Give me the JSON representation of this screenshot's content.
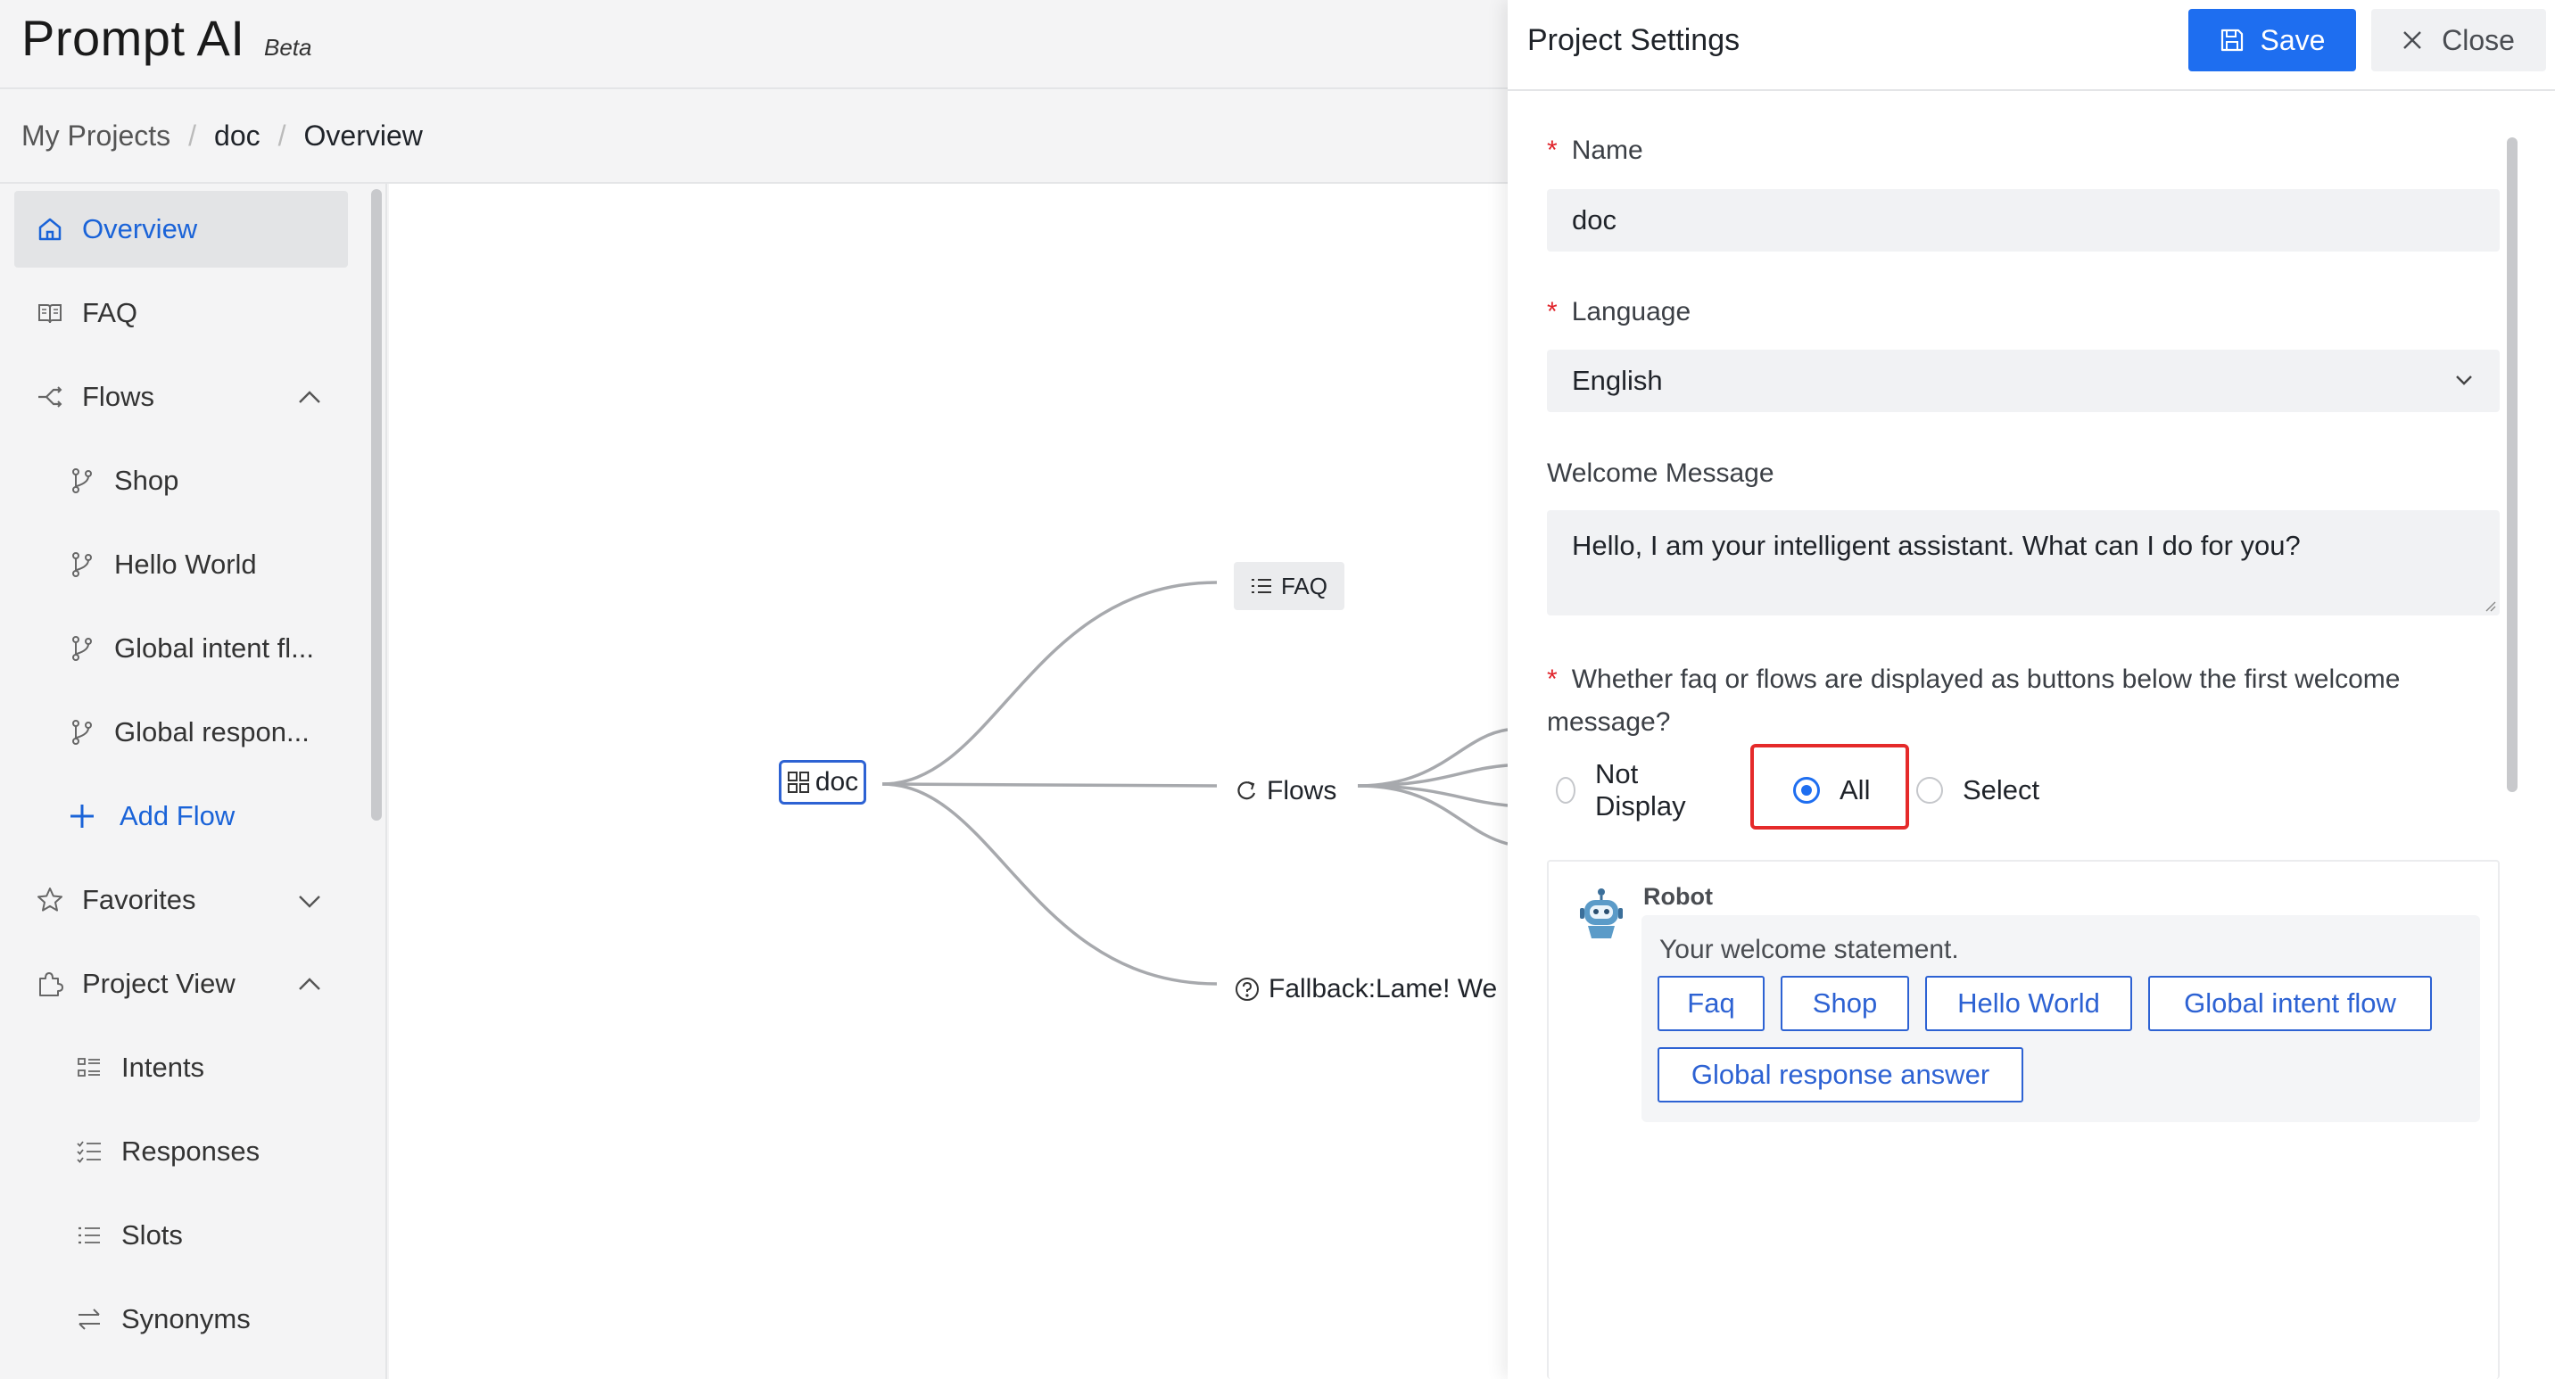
{
  "header": {
    "brand": "Prompt AI",
    "badge": "Beta"
  },
  "breadcrumb": [
    "My Projects",
    "doc",
    "Overview"
  ],
  "sidebar": {
    "overview": "Overview",
    "faq": "FAQ",
    "flows": "Flows",
    "flow_items": [
      "Shop",
      "Hello World",
      "Global intent fl...",
      "Global respon..."
    ],
    "add_flow": "Add Flow",
    "favorites": "Favorites",
    "project_view": "Project View",
    "project_items": [
      "Intents",
      "Responses",
      "Slots",
      "Synonyms"
    ]
  },
  "canvas": {
    "root": "doc",
    "faq_node": "FAQ",
    "flows_node": "Flows",
    "fallback_node": "Fallback:Lame! We"
  },
  "settings": {
    "title": "Project Settings",
    "save_label": "Save",
    "close_label": "Close",
    "name_label": "Name",
    "name_value": "doc",
    "language_label": "Language",
    "language_value": "English",
    "welcome_label": "Welcome Message",
    "welcome_value": "Hello, I am your intelligent assistant. What can I do for you?",
    "buttons_question_line1": "Whether faq or flows are displayed as buttons below the first welcome",
    "buttons_question_line2": "message?",
    "options": [
      "Not Display",
      "All",
      "Select"
    ],
    "selected_option": "All"
  },
  "preview": {
    "sender": "Robot",
    "statement": "Your welcome statement.",
    "buttons": [
      "Faq",
      "Shop",
      "Hello World",
      "Global intent flow",
      "Global response answer"
    ]
  },
  "colors": {
    "primary": "#1e6ef0",
    "highlight": "#e52a2a",
    "required": "#e0242b"
  }
}
